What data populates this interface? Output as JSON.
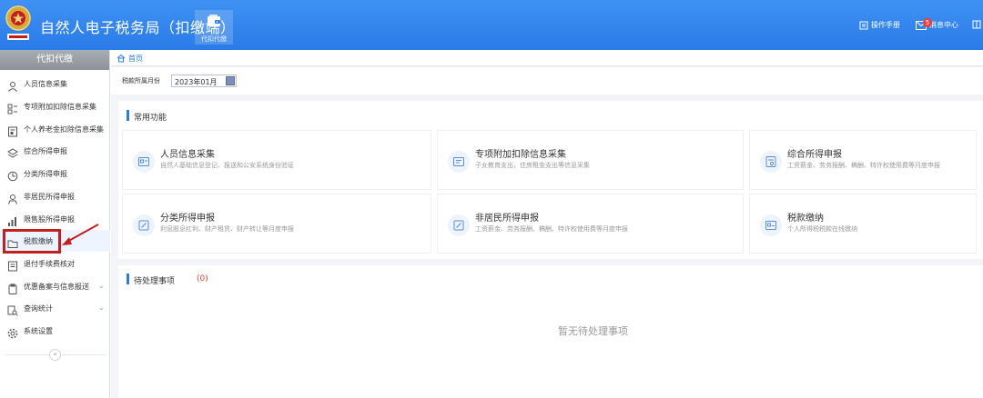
{
  "header": {
    "app_title": "自然人电子税务局（扣缴端）",
    "module_tab_label": "代扣代缴",
    "manual_label": "操作手册",
    "message_label": "消息中心",
    "message_badge": "5"
  },
  "sidebar": {
    "title": "代扣代缴",
    "items": [
      {
        "label": "人员信息采集",
        "icon": "person-icon"
      },
      {
        "label": "专项附加扣除信息采集",
        "icon": "grid-list-icon"
      },
      {
        "label": "个人养老金扣除信息采集",
        "icon": "pension-card-icon"
      },
      {
        "label": "综合所得申报",
        "icon": "layers-icon"
      },
      {
        "label": "分类所得申报",
        "icon": "pie-clock-icon"
      },
      {
        "label": "非居民所得申报",
        "icon": "person-outline-icon"
      },
      {
        "label": "限售股所得申报",
        "icon": "bar-chart-icon"
      },
      {
        "label": "税款缴纳",
        "icon": "folder-icon"
      },
      {
        "label": "退付手续费核对",
        "icon": "document-icon"
      },
      {
        "label": "优惠备案与信息报送",
        "icon": "clipboard-icon",
        "expandable": true
      },
      {
        "label": "查询统计",
        "icon": "search-doc-icon",
        "expandable": true
      },
      {
        "label": "系统设置",
        "icon": "gear-icon"
      }
    ],
    "collapse_symbol": "«"
  },
  "breadcrumb": {
    "home": "首页"
  },
  "filter": {
    "label": "税款所属月份",
    "value": "2023年01月"
  },
  "common_functions": {
    "title": "常用功能",
    "cards": [
      {
        "title": "人员信息采集",
        "desc": "自然人基础信息登记、报送和公安系统身份验证"
      },
      {
        "title": "专项附加扣除信息采集",
        "desc": "子女教育支出，住房租金支出等信息采集"
      },
      {
        "title": "综合所得申报",
        "desc": "工资薪金、劳务报酬、稿酬、特许权使用费等月度申报"
      },
      {
        "title": "分类所得申报",
        "desc": "利息股息红利、财产租赁、财产转让等月度申报"
      },
      {
        "title": "非居民所得申报",
        "desc": "工资薪金、劳务报酬、稿酬、特许权使用费等月度申报"
      },
      {
        "title": "税款缴纳",
        "desc": "个人所得税税款在线缴纳"
      }
    ]
  },
  "todo": {
    "title": "待处理事项",
    "count": "(0)",
    "empty_text": "暂无待处理事项"
  },
  "colors": {
    "header_blue": "#2a7be8",
    "highlight_red": "#c0211f",
    "accent_blue": "#2a7be8"
  }
}
